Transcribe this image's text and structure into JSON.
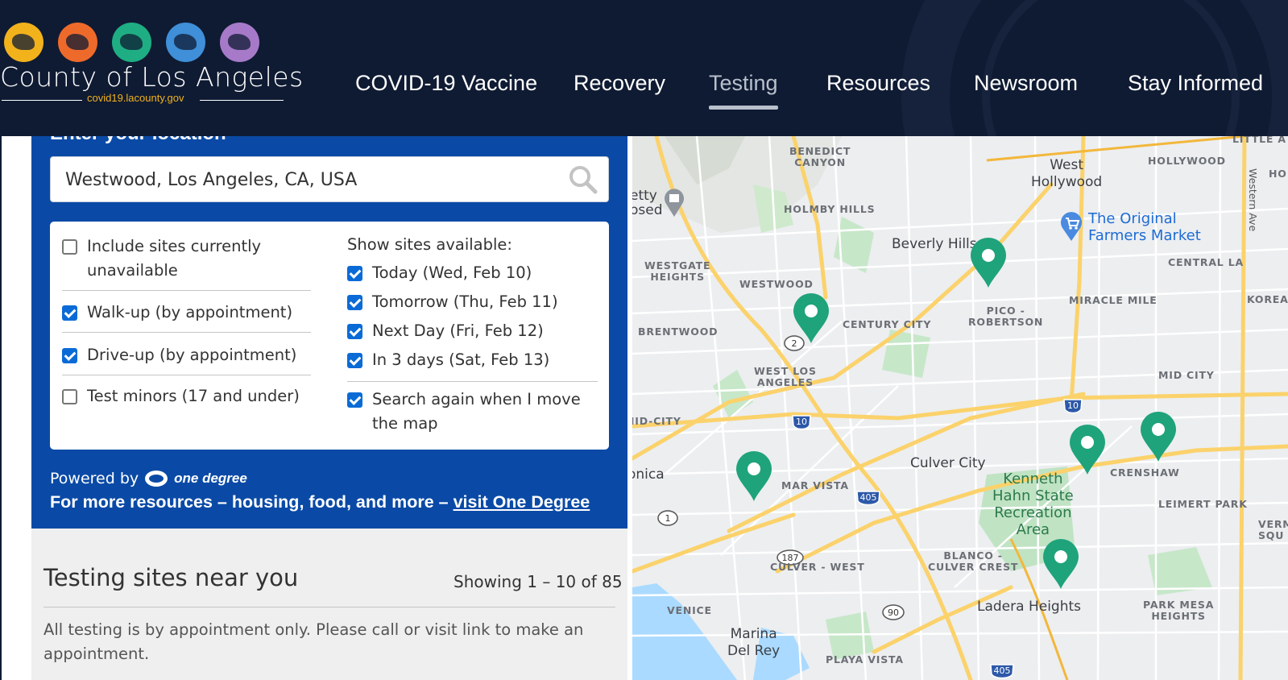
{
  "header": {
    "logo_title": "County of Los Angeles",
    "logo_subtitle": "covid19.lacounty.gov",
    "nav": [
      {
        "label": "COVID-19 Vaccine"
      },
      {
        "label": "Recovery"
      },
      {
        "label": "Testing"
      },
      {
        "label": "Resources"
      },
      {
        "label": "Newsroom"
      },
      {
        "label": "Stay Informed"
      }
    ],
    "active_nav": "Testing"
  },
  "search": {
    "heading": "Enter your location",
    "value": "Westwood, Los Angeles, CA, USA",
    "placeholder": "Enter your location"
  },
  "filters": {
    "left": [
      {
        "label": "Include sites currently unavailable",
        "checked": false
      },
      {
        "label": "Walk-up (by appointment)",
        "checked": true
      },
      {
        "label": "Drive-up (by appointment)",
        "checked": true
      },
      {
        "label": "Test minors (17 and under)",
        "checked": false
      }
    ],
    "right_heading": "Show sites available:",
    "right": [
      {
        "label": "Today (Wed, Feb 10)",
        "checked": true
      },
      {
        "label": "Tomorrow (Thu, Feb 11)",
        "checked": true
      },
      {
        "label": "Next Day (Fri, Feb 12)",
        "checked": true
      },
      {
        "label": "In 3 days (Sat, Feb 13)",
        "checked": true
      }
    ],
    "search_again": {
      "label": "Search again when I move the map",
      "checked": true
    }
  },
  "powered": {
    "prefix": "Powered by",
    "brand": "one degree",
    "more_text": "For more resources – housing, food, and more – ",
    "more_link": "visit One Degree"
  },
  "results": {
    "title": "Testing sites near you",
    "count": "Showing 1 – 10 of 85",
    "note": "All testing is by appointment only. Please call or visit link to make an appointment."
  },
  "map": {
    "labels": [
      {
        "text": "BENEDICT\nCANYON"
      },
      {
        "text": "HOLMBY HILLS"
      },
      {
        "text": "WESTGATE\nHEIGHTS"
      },
      {
        "text": "WESTWOOD"
      },
      {
        "text": "BRENTWOOD"
      },
      {
        "text": "CENTURY CITY"
      },
      {
        "text": "PICO -\nROBERTSON"
      },
      {
        "text": "MIRACLE MILE"
      },
      {
        "text": "CENTRAL LA"
      },
      {
        "text": "HOLLYWOOD"
      },
      {
        "text": "LITTLE A"
      },
      {
        "text": "KOREA"
      },
      {
        "text": "MID CITY"
      },
      {
        "text": "WEST LOS\nANGELES"
      },
      {
        "text": "MID-CITY"
      },
      {
        "text": "MAR VISTA"
      },
      {
        "text": "CRENSHAW"
      },
      {
        "text": "LEIMERT PARK"
      },
      {
        "text": "VERM\nSQU"
      },
      {
        "text": "CULVER - WEST"
      },
      {
        "text": "BLANCO -\nCULVER CREST"
      },
      {
        "text": "PARK MESA\nHEIGHTS"
      },
      {
        "text": "VENICE"
      },
      {
        "text": "PLAYA VISTA"
      },
      {
        "text": "HO"
      }
    ],
    "cities": [
      {
        "text": "West\nHollywood"
      },
      {
        "text": "Beverly Hills"
      },
      {
        "text": "Culver City"
      },
      {
        "text": "Ladera Heights"
      },
      {
        "text": "Marina\nDel Rey"
      },
      {
        "text": "onica"
      },
      {
        "text": "etty\nosed"
      }
    ],
    "parks": [
      {
        "text": "Kenneth\nHahn State\nRecreation\nArea"
      }
    ],
    "poi": {
      "text": "The Original\nFarmers Market"
    },
    "street": "Western Ave",
    "shields": [
      {
        "text": "2"
      },
      {
        "text": "10"
      },
      {
        "text": "10"
      },
      {
        "text": "405"
      },
      {
        "text": "1"
      },
      {
        "text": "187"
      },
      {
        "text": "90"
      },
      {
        "text": "405"
      }
    ],
    "pins": 6
  },
  "colors": {
    "header_bg": "#0f1b33",
    "panel_bg": "#0a4aa6",
    "checkbox": "#0a6bd6",
    "pin": "#1fa37a"
  }
}
